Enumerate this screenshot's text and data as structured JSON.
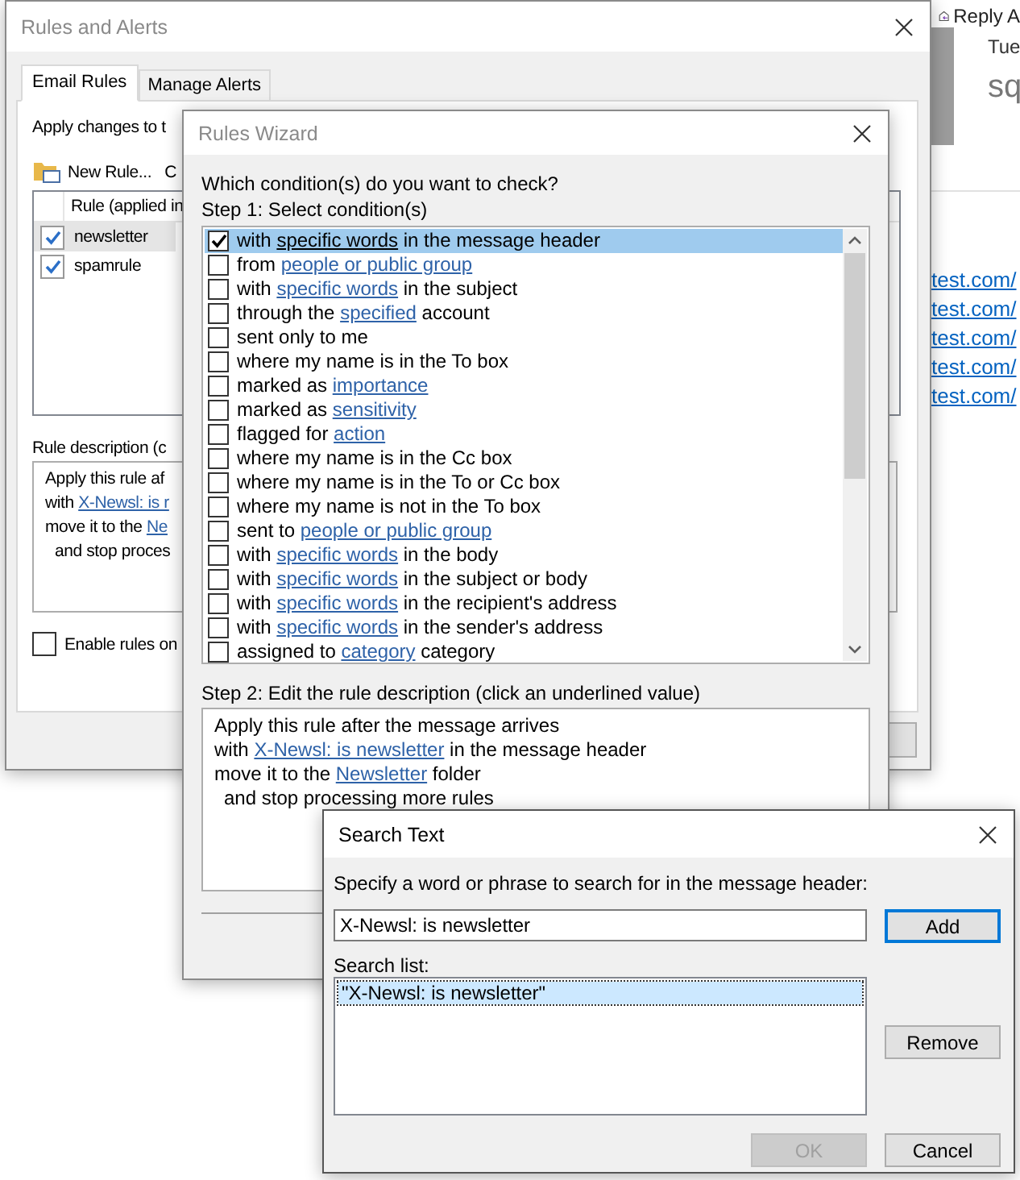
{
  "background_app": {
    "reply_button": "Reply A",
    "date": "Tue",
    "subject": "sq",
    "links": [
      "test.com/",
      "test.com/",
      "test.com/",
      "test.com/",
      "test.com/"
    ]
  },
  "rules_and_alerts": {
    "title": "Rules and Alerts",
    "tabs": [
      {
        "label": "Email Rules",
        "selected": true
      },
      {
        "label": "Manage Alerts",
        "selected": false
      }
    ],
    "apply_label": "Apply changes to t",
    "toolbar": {
      "new_rule": "New Rule...",
      "column_2": "C"
    },
    "list_header": "Rule (applied in",
    "rules": [
      {
        "name": "newsletter",
        "checked": true,
        "selected": true
      },
      {
        "name": "spamrule",
        "checked": true,
        "selected": false
      }
    ],
    "description_label": "Rule description (c",
    "description_lines": [
      {
        "indented": false,
        "parts": [
          {
            "text": "Apply this rule af",
            "link": false
          }
        ]
      },
      {
        "indented": false,
        "parts": [
          {
            "text": "with ",
            "link": false
          },
          {
            "text": "X-Newsl: is r",
            "link": true
          }
        ]
      },
      {
        "indented": false,
        "parts": [
          {
            "text": "move it to the ",
            "link": false
          },
          {
            "text": "Ne",
            "link": true
          }
        ]
      },
      {
        "indented": true,
        "parts": [
          {
            "text": "and stop proces",
            "link": false
          }
        ]
      }
    ],
    "enable_rules": {
      "label": "Enable rules on",
      "checked": false
    }
  },
  "rules_wizard": {
    "title": "Rules Wizard",
    "question": "Which condition(s) do you want to check?",
    "step1": "Step 1: Select condition(s)",
    "conditions": [
      {
        "checked": true,
        "selected": true,
        "parts": [
          {
            "text": "with ",
            "link": false
          },
          {
            "text": "specific words",
            "link": true
          },
          {
            "text": " in the message header",
            "link": false
          }
        ]
      },
      {
        "checked": false,
        "selected": false,
        "parts": [
          {
            "text": "from ",
            "link": false
          },
          {
            "text": "people or public group",
            "link": true
          }
        ]
      },
      {
        "checked": false,
        "selected": false,
        "parts": [
          {
            "text": "with ",
            "link": false
          },
          {
            "text": "specific words",
            "link": true
          },
          {
            "text": " in the subject",
            "link": false
          }
        ]
      },
      {
        "checked": false,
        "selected": false,
        "parts": [
          {
            "text": "through the ",
            "link": false
          },
          {
            "text": "specified",
            "link": true
          },
          {
            "text": " account",
            "link": false
          }
        ]
      },
      {
        "checked": false,
        "selected": false,
        "parts": [
          {
            "text": "sent only to me",
            "link": false
          }
        ]
      },
      {
        "checked": false,
        "selected": false,
        "parts": [
          {
            "text": "where my name is in the To box",
            "link": false
          }
        ]
      },
      {
        "checked": false,
        "selected": false,
        "parts": [
          {
            "text": "marked as ",
            "link": false
          },
          {
            "text": "importance",
            "link": true
          }
        ]
      },
      {
        "checked": false,
        "selected": false,
        "parts": [
          {
            "text": "marked as ",
            "link": false
          },
          {
            "text": "sensitivity",
            "link": true
          }
        ]
      },
      {
        "checked": false,
        "selected": false,
        "parts": [
          {
            "text": "flagged for ",
            "link": false
          },
          {
            "text": "action",
            "link": true
          }
        ]
      },
      {
        "checked": false,
        "selected": false,
        "parts": [
          {
            "text": "where my name is in the Cc box",
            "link": false
          }
        ]
      },
      {
        "checked": false,
        "selected": false,
        "parts": [
          {
            "text": "where my name is in the To or Cc box",
            "link": false
          }
        ]
      },
      {
        "checked": false,
        "selected": false,
        "parts": [
          {
            "text": "where my name is not in the To box",
            "link": false
          }
        ]
      },
      {
        "checked": false,
        "selected": false,
        "parts": [
          {
            "text": "sent to ",
            "link": false
          },
          {
            "text": "people or public group",
            "link": true
          }
        ]
      },
      {
        "checked": false,
        "selected": false,
        "parts": [
          {
            "text": "with ",
            "link": false
          },
          {
            "text": "specific words",
            "link": true
          },
          {
            "text": " in the body",
            "link": false
          }
        ]
      },
      {
        "checked": false,
        "selected": false,
        "parts": [
          {
            "text": "with ",
            "link": false
          },
          {
            "text": "specific words",
            "link": true
          },
          {
            "text": " in the subject or body",
            "link": false
          }
        ]
      },
      {
        "checked": false,
        "selected": false,
        "parts": [
          {
            "text": "with ",
            "link": false
          },
          {
            "text": "specific words",
            "link": true
          },
          {
            "text": " in the recipient's address",
            "link": false
          }
        ]
      },
      {
        "checked": false,
        "selected": false,
        "parts": [
          {
            "text": "with ",
            "link": false
          },
          {
            "text": "specific words",
            "link": true
          },
          {
            "text": " in the sender's address",
            "link": false
          }
        ]
      },
      {
        "checked": false,
        "selected": false,
        "parts": [
          {
            "text": "assigned to ",
            "link": false
          },
          {
            "text": "category",
            "link": true
          },
          {
            "text": " category",
            "link": false
          }
        ]
      }
    ],
    "step2": "Step 2: Edit the rule description (click an underlined value)",
    "description_lines": [
      {
        "indented": false,
        "parts": [
          {
            "text": "Apply this rule after the message arrives",
            "link": false
          }
        ]
      },
      {
        "indented": false,
        "parts": [
          {
            "text": "with ",
            "link": false
          },
          {
            "text": "X-Newsl: is newsletter",
            "link": true
          },
          {
            "text": " in the message header",
            "link": false
          }
        ]
      },
      {
        "indented": false,
        "parts": [
          {
            "text": "move it to the ",
            "link": false
          },
          {
            "text": "Newsletter",
            "link": true
          },
          {
            "text": " folder",
            "link": false
          }
        ]
      },
      {
        "indented": true,
        "parts": [
          {
            "text": "and stop processing more rules",
            "link": false
          }
        ]
      }
    ]
  },
  "search_text": {
    "title": "Search Text",
    "prompt": "Specify a word or phrase to search for in the message header:",
    "input_value": "X-Newsl: is newsletter",
    "add_button": "Add",
    "list_label": "Search list:",
    "items": [
      {
        "text": "\"X-Newsl: is newsletter\"",
        "selected": true
      }
    ],
    "remove_button": "Remove",
    "ok_button": {
      "label": "OK",
      "disabled": true
    },
    "cancel_button": "Cancel"
  }
}
